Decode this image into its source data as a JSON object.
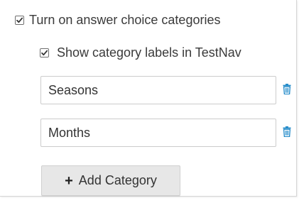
{
  "categories_toggle": {
    "label": "Turn on answer choice categories",
    "checked": true
  },
  "show_labels_toggle": {
    "label": "Show category labels in TestNav",
    "checked": true
  },
  "categories": [
    {
      "value": "Seasons",
      "delete_icon": "trash-icon"
    },
    {
      "value": "Months",
      "delete_icon": "trash-icon"
    }
  ],
  "add_category_button": {
    "icon": "plus-icon",
    "label": "Add Category"
  },
  "colors": {
    "delete_icon": "#1e88c8",
    "button_bg": "#e7e7e7",
    "text": "#333333"
  }
}
